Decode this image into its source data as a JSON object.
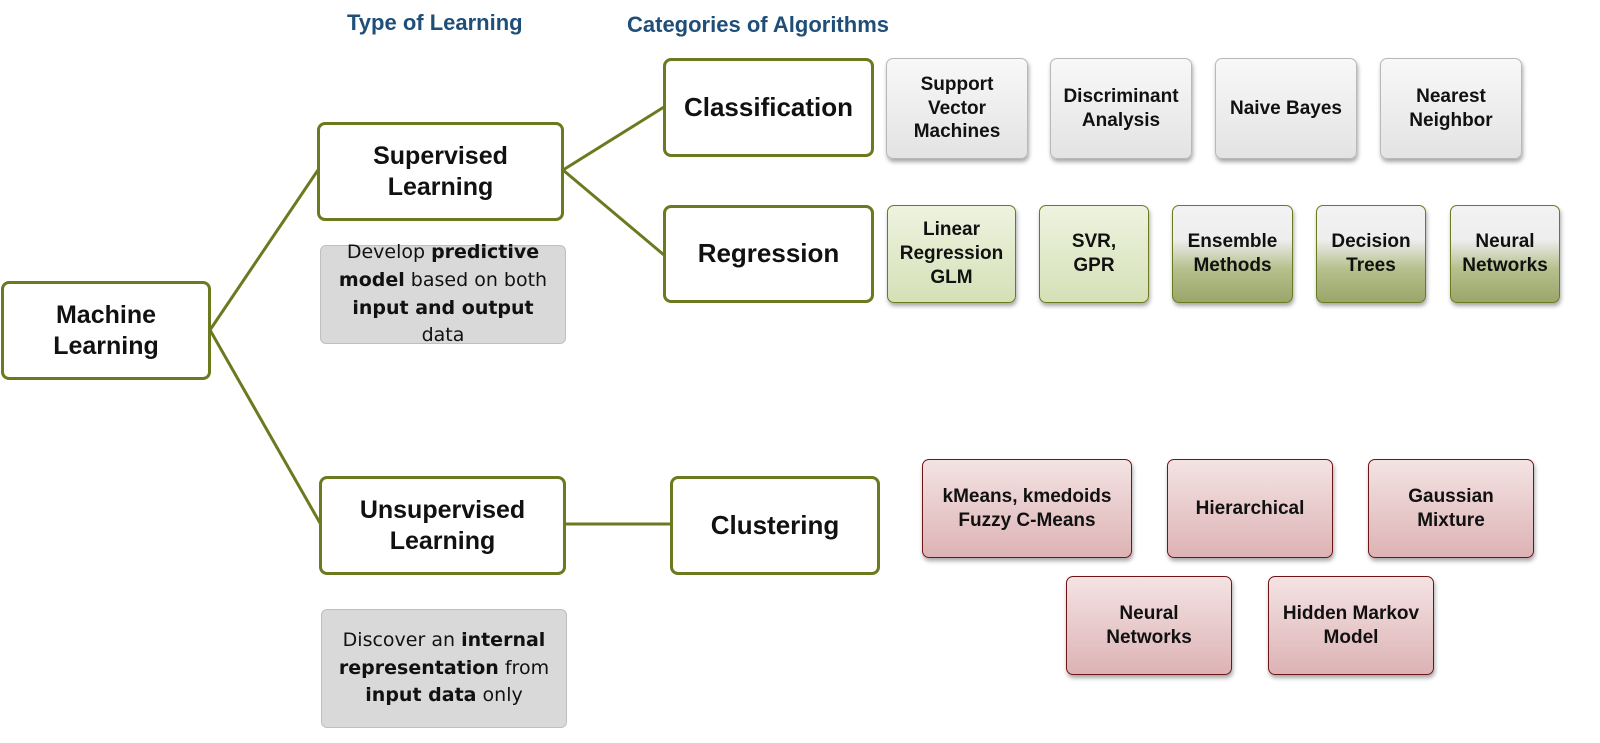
{
  "headers": {
    "type_of_learning": "Type of Learning",
    "categories_of_algorithms": "Categories of Algorithms"
  },
  "root": {
    "line1": "Machine",
    "line2": "Learning"
  },
  "supervised": {
    "line1": "Supervised",
    "line2": "Learning",
    "description": [
      [
        {
          "t": "Develop ",
          "b": false
        },
        {
          "t": "predictive",
          "b": true
        }
      ],
      [
        {
          "t": "model",
          "b": true
        },
        {
          "t": " based on both",
          "b": false
        }
      ],
      [
        {
          "t": "input and output",
          "b": true
        },
        {
          "t": " data",
          "b": false
        }
      ]
    ]
  },
  "unsupervised": {
    "line1": "Unsupervised",
    "line2": "Learning",
    "description": [
      [
        {
          "t": "Discover an ",
          "b": false
        },
        {
          "t": "internal",
          "b": true
        }
      ],
      [
        {
          "t": "representation",
          "b": true
        },
        {
          "t": " from",
          "b": false
        }
      ],
      [
        {
          "t": "input data",
          "b": true
        },
        {
          "t": " only",
          "b": false
        }
      ]
    ]
  },
  "categories": {
    "classification": "Classification",
    "regression": "Regression",
    "clustering": "Clustering"
  },
  "algorithms": {
    "classification": [
      "Support\nVector\nMachines",
      "Discriminant\nAnalysis",
      "Naive Bayes",
      "Nearest\nNeighbor"
    ],
    "regression": [
      "Linear\nRegression\nGLM",
      "SVR,\nGPR",
      "Ensemble\nMethods",
      "Decision\nTrees",
      "Neural\nNetworks"
    ],
    "clustering": [
      "kMeans, kmedoids\nFuzzy C-Means",
      "Hierarchical",
      "Gaussian\nMixture",
      "Neural\nNetworks",
      "Hidden Markov\nModel"
    ]
  },
  "colors": {
    "connector": "#6b7a1f",
    "header": "#1f4e79",
    "classification_fill": "#e8e8e8",
    "regression_light_fill": "#dfe8c8",
    "regression_dark_fill": "#a4af74",
    "clustering_fill": "#e8c6c7",
    "clustering_border": "#6e1518"
  }
}
